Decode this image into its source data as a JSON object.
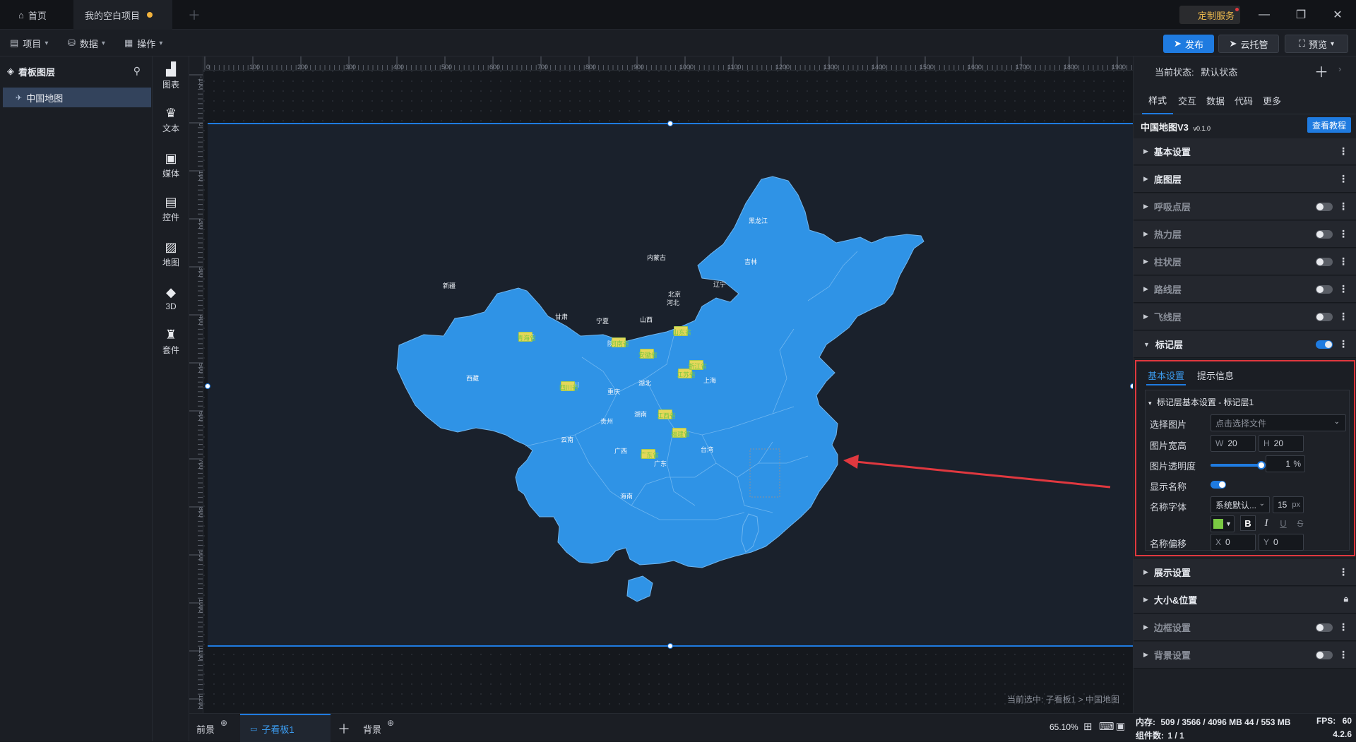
{
  "tabs": [
    {
      "label": "首页"
    },
    {
      "label": "我的空白项目"
    }
  ],
  "custom_service": "定制服务",
  "menu": {
    "project": "项目",
    "data": "数据",
    "operation": "操作"
  },
  "toolbar": {
    "publish": "发布",
    "cloud": "云托管",
    "preview": "预览"
  },
  "layers": {
    "title": "看板图层",
    "items": [
      "中国地图"
    ]
  },
  "rail": [
    "图表",
    "文本",
    "媒体",
    "控件",
    "地图",
    "3D",
    "套件"
  ],
  "ruler": {
    "top": [
      "0",
      "100",
      "200",
      "300",
      "400",
      "500",
      "600",
      "700",
      "800",
      "900",
      "1000",
      "1100",
      "1200",
      "1300",
      "1400",
      "1500",
      "1600",
      "1700",
      "1800",
      "1900"
    ],
    "left": [
      "-100",
      "0",
      "100",
      "200",
      "300",
      "400",
      "500",
      "600",
      "700",
      "800",
      "900",
      "1000",
      "1100",
      "1200"
    ]
  },
  "map": {
    "provinces": [
      "新疆",
      "西藏",
      "甘肃",
      "青海",
      "内蒙古",
      "黑龙江",
      "吉林",
      "辽宁",
      "北京",
      "河北",
      "山西",
      "宁夏",
      "陕西",
      "湖北",
      "四川",
      "重庆",
      "湖南",
      "贵州",
      "云南",
      "广西",
      "广东",
      "海南",
      "台湾",
      "上海",
      "山东",
      "江苏",
      "安徽",
      "浙江",
      "江西",
      "福建",
      "河南"
    ],
    "markers": [
      "青海省",
      "河南省",
      "山东省",
      "江苏省",
      "安徽省",
      "四川省",
      "浙江省",
      "江西省",
      "福建省",
      "广东省"
    ]
  },
  "canvas": {
    "breadcrumb": "当前选中: 子看板1 > 中国地图"
  },
  "bottom": {
    "foreground": "前景",
    "subboard": "子看板1",
    "background": "背景",
    "zoom": "65.10%"
  },
  "status": {
    "memory_label": "内存:",
    "memory_value": "509 / 3566 / 4096 MB  44 / 553 MB",
    "fps_label": "FPS:",
    "fps_value": "60",
    "components_label": "组件数:",
    "components_value": "1 / 1",
    "version": "4.2.6"
  },
  "right": {
    "state_label": "当前状态:",
    "state_value": "默认状态",
    "tabs": [
      "样式",
      "交互",
      "数据",
      "代码",
      "更多"
    ],
    "component_name": "中国地图V3",
    "component_version": "v0.1.0",
    "tutorial": "查看教程",
    "sections": {
      "basic": "基本设置",
      "base_layer": "底图层",
      "breath": "呼吸点层",
      "heat": "热力层",
      "bar": "柱状层",
      "route": "路线层",
      "fly": "飞线层",
      "marker": "标记层",
      "display": "展示设置",
      "size": "大小&位置",
      "border": "边框设置",
      "bg": "背景设置"
    },
    "marker_panel": {
      "tabs": [
        "基本设置",
        "提示信息"
      ],
      "group_title": "标记层基本设置 - 标记层1",
      "select_image_label": "选择图片",
      "select_image_placeholder": "点击选择文件",
      "size_label": "图片宽高",
      "w_label": "W",
      "w_value": "20",
      "h_label": "H",
      "h_value": "20",
      "opacity_label": "图片透明度",
      "opacity_value": "1",
      "opacity_unit": "%",
      "opacity_level": 1.0,
      "show_name_label": "显示名称",
      "font_label": "名称字体",
      "font_value": "系统默认...",
      "font_size": "15",
      "font_unit": "px",
      "font_color": "#7ac943",
      "offset_label": "名称偏移",
      "x_label": "X",
      "x_value": "0",
      "y_label": "Y",
      "y_value": "0"
    }
  },
  "colors": {
    "accent": "#1f7be0",
    "map_fill": "#2f93e6",
    "highlight": "#e0383f"
  }
}
